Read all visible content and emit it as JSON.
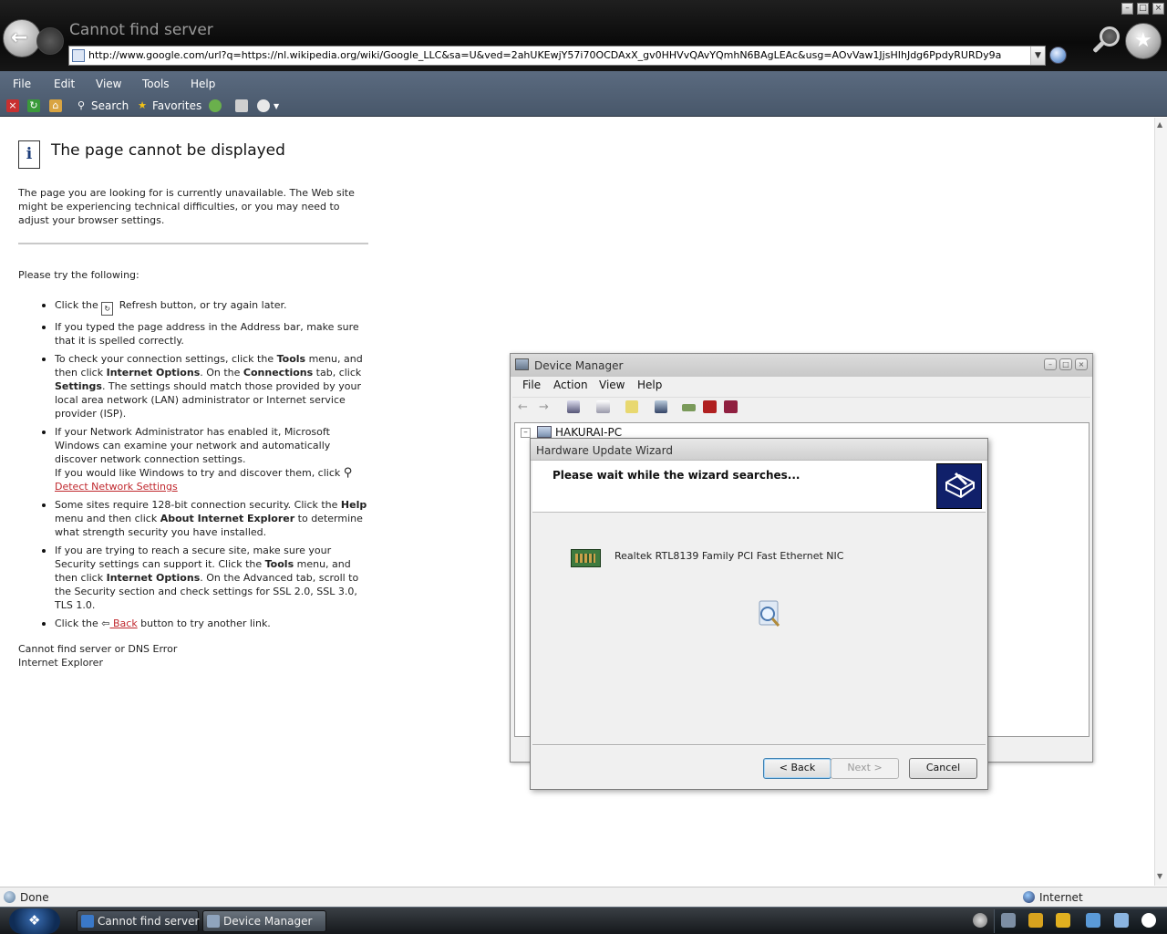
{
  "browser": {
    "window_title": "Cannot find server",
    "address": "http://www.google.com/url?q=https://nl.wikipedia.org/wiki/Google_LLC&sa=U&ved=2ahUKEwjY57i70OCDAxX_gv0HHVvQAvYQmhN6BAgLEAc&usg=AOvVaw1JjsHIhJdg6PpdyRURDy9a",
    "menu": [
      "File",
      "Edit",
      "View",
      "Tools",
      "Help"
    ],
    "toolbar": {
      "search_label": "Search",
      "favorites_label": "Favorites"
    },
    "status_text": "Done",
    "zone_text": "Internet"
  },
  "page": {
    "heading": "The page cannot be displayed",
    "intro": "The page you are looking for is currently unavailable. The Web site might be experiencing technical difficulties, or you may need to adjust your browser settings.",
    "try_heading": "Please try the following:",
    "tips": {
      "refresh_pre": "Click the ",
      "refresh_post": " Refresh button, or try again later.",
      "address": "If you typed the page address in the Address bar, make sure that it is spelled correctly.",
      "conn_1": "To check your connection settings, click the ",
      "conn_tools": "Tools",
      "conn_2": " menu, and then click ",
      "conn_options": "Internet Options",
      "conn_3": ". On the ",
      "conn_connections": "Connections",
      "conn_4": " tab, click ",
      "conn_settings": "Settings",
      "conn_5": ". The settings should match those provided by your local area network (LAN) administrator or Internet service provider (ISP).",
      "admin_1": "If your Network Administrator has enabled it, Microsoft Windows can examine your network and automatically discover network connection settings.",
      "admin_2": "If you would like Windows to try and discover them, click ",
      "detect_link": " Detect Network Settings",
      "sec_1": "Some sites require 128-bit connection security. Click the ",
      "sec_help": "Help",
      "sec_2": " menu and then click ",
      "sec_about": "About Internet Explorer",
      "sec_3": " to determine what strength security you have installed.",
      "secure_1": "If you are trying to reach a secure site, make sure your Security settings can support it. Click the ",
      "secure_tools": "Tools",
      "secure_2": " menu, and then click ",
      "secure_options": "Internet Options",
      "secure_3": ". On the Advanced tab, scroll to the Security section and check settings for SSL 2.0, SSL 3.0, TLS 1.0.",
      "back_pre": "Click the ",
      "back_link": " Back",
      "back_post": " button to try another link."
    },
    "footer_line1": "Cannot find server or DNS Error",
    "footer_line2": "Internet Explorer"
  },
  "device_manager": {
    "title": "Device Manager",
    "menu": [
      "File",
      "Action",
      "View",
      "Help"
    ],
    "tree_root": "HAKURAI-PC"
  },
  "wizard": {
    "title": "Hardware Update Wizard",
    "heading": "Please wait while the wizard searches...",
    "device": "Realtek RTL8139 Family PCI Fast Ethernet NIC",
    "back_label": "< Back",
    "next_label": "Next >",
    "cancel_label": "Cancel"
  },
  "taskbar": {
    "items": [
      "Cannot find server",
      "Device Manager"
    ]
  },
  "colors": {
    "link_red": "#c0282e",
    "menubar": "#4f5f73",
    "wizard_logo": "#10206a"
  }
}
